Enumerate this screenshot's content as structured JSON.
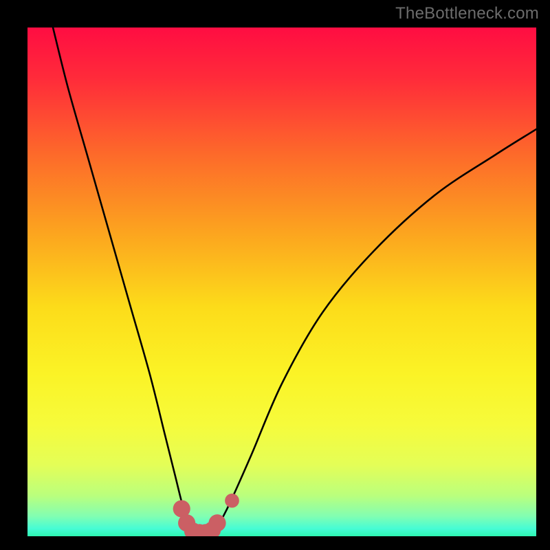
{
  "watermark": "TheBottleneck.com",
  "colors": {
    "black": "#000000",
    "curve": "#000000",
    "marker": "#cb5f64",
    "gradient": [
      {
        "stop": 0.0,
        "hex": "#ff0d42"
      },
      {
        "stop": 0.1,
        "hex": "#ff2b3a"
      },
      {
        "stop": 0.25,
        "hex": "#fd6a2a"
      },
      {
        "stop": 0.4,
        "hex": "#fca31f"
      },
      {
        "stop": 0.55,
        "hex": "#fcdc1a"
      },
      {
        "stop": 0.68,
        "hex": "#fbf326"
      },
      {
        "stop": 0.78,
        "hex": "#f6fb3b"
      },
      {
        "stop": 0.86,
        "hex": "#e4fe57"
      },
      {
        "stop": 0.92,
        "hex": "#baff7d"
      },
      {
        "stop": 0.96,
        "hex": "#83feb1"
      },
      {
        "stop": 0.985,
        "hex": "#46fcd5"
      },
      {
        "stop": 1.0,
        "hex": "#2df6b1"
      }
    ]
  },
  "chart_data": {
    "type": "line",
    "title": "",
    "xlabel": "",
    "ylabel": "",
    "xlim": [
      0,
      100
    ],
    "ylim": [
      0,
      100
    ],
    "grid": false,
    "legend": false,
    "series": [
      {
        "name": "bottleneck-curve",
        "x": [
          5,
          8,
          12,
          16,
          20,
          24,
          27,
          29,
          30.5,
          31.5,
          32.5,
          34,
          36,
          37,
          38,
          40,
          44,
          50,
          58,
          68,
          80,
          92,
          100
        ],
        "y": [
          100,
          88,
          74,
          60,
          46,
          32,
          20,
          12,
          6,
          3,
          1.2,
          0.7,
          0.7,
          1.2,
          3,
          7,
          16,
          30,
          44,
          56,
          67,
          75,
          80
        ]
      }
    ],
    "markers": [
      {
        "name": "valley-left-1",
        "x": 30.3,
        "y": 5.4,
        "r": 1.7
      },
      {
        "name": "valley-left-2",
        "x": 31.3,
        "y": 2.6,
        "r": 1.7
      },
      {
        "name": "valley-left-3",
        "x": 32.5,
        "y": 1.0,
        "r": 1.7
      },
      {
        "name": "valley-bot-1",
        "x": 33.8,
        "y": 0.7,
        "r": 1.7
      },
      {
        "name": "valley-bot-2",
        "x": 35.0,
        "y": 0.7,
        "r": 1.7
      },
      {
        "name": "valley-right-1",
        "x": 36.3,
        "y": 1.2,
        "r": 1.7
      },
      {
        "name": "valley-right-2",
        "x": 37.3,
        "y": 2.6,
        "r": 1.7
      },
      {
        "name": "valley-out",
        "x": 40.2,
        "y": 7.0,
        "r": 1.4
      }
    ]
  }
}
